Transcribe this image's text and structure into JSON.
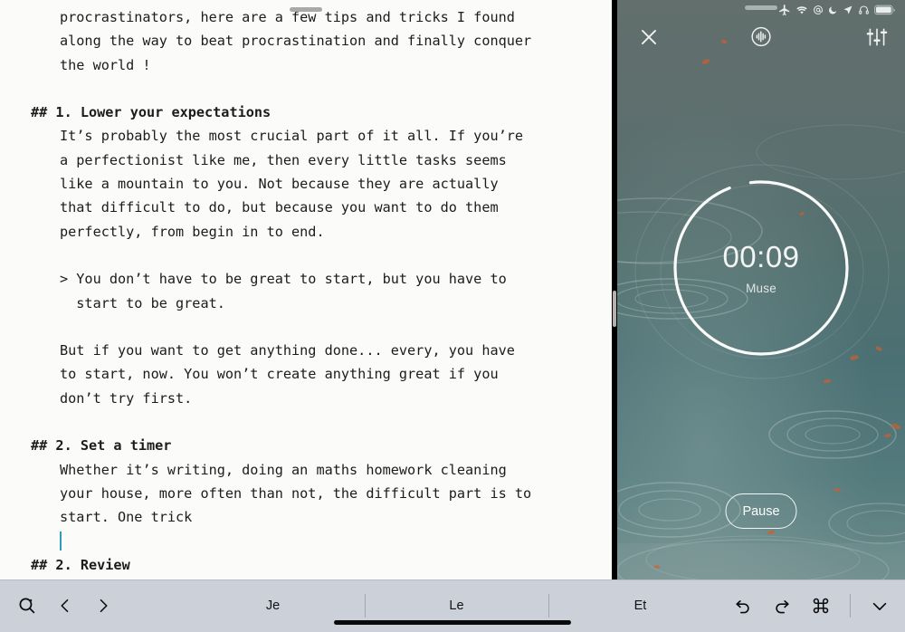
{
  "window": {
    "left_pane_name": "markdown-editor",
    "right_pane_name": "focus-timer"
  },
  "editor": {
    "document_lines": [
      {
        "type": "body",
        "text": "procrastinators, here are a few tips and tricks I found"
      },
      {
        "type": "body",
        "text": "along the way to beat procrastination and finally conquer"
      },
      {
        "type": "body",
        "text": "the world !"
      },
      {
        "type": "blank",
        "text": ""
      },
      {
        "type": "heading",
        "hashes": "##",
        "text": "1. Lower your expectations"
      },
      {
        "type": "body",
        "text": "It’s probably the most crucial part of it all. If you’re"
      },
      {
        "type": "body",
        "text": "a perfectionist like me, then every little tasks seems"
      },
      {
        "type": "body",
        "text": "like a mountain to you. Not because they are actually"
      },
      {
        "type": "body",
        "text": "that difficult to do, but because you want to do them"
      },
      {
        "type": "body",
        "text": "perfectly, from begin in to end."
      },
      {
        "type": "blank",
        "text": ""
      },
      {
        "type": "quote",
        "text": "> You don’t have to be great to start, but you have to"
      },
      {
        "type": "quote-cont",
        "text": "  start to be great."
      },
      {
        "type": "blank",
        "text": ""
      },
      {
        "type": "body",
        "text": "But if you want to get anything done... every, you have"
      },
      {
        "type": "body",
        "text": "to start, now. You won’t create anything great if you"
      },
      {
        "type": "body",
        "text": "don’t try first."
      },
      {
        "type": "blank",
        "text": ""
      },
      {
        "type": "heading",
        "hashes": "##",
        "text": "2. Set a timer"
      },
      {
        "type": "body",
        "text": "Whether it’s writing, doing an maths homework cleaning"
      },
      {
        "type": "body",
        "text": "your house, more often than not, the difficult part is to"
      },
      {
        "type": "body",
        "text": "start. One trick"
      },
      {
        "type": "caret",
        "text": ""
      },
      {
        "type": "heading",
        "hashes": "##",
        "text": "2. Review"
      }
    ],
    "caret_color": "#2f9bbd"
  },
  "timer": {
    "status_icons": [
      "airplane-mode-icon",
      "wifi-icon",
      "at-symbol-icon",
      "do-not-disturb-moon-icon",
      "location-arrow-icon",
      "headphones-icon",
      "battery-icon"
    ],
    "close_label": "close-icon",
    "sound_toggle_label": "sound-wave-icon",
    "mixer_label": "mixer-sliders-icon",
    "elapsed": "00:09",
    "sound_name": "Muse",
    "pause_label": "Pause",
    "progress_percent": 4,
    "ring_color": "#ffffff",
    "background_name": "rain-on-water-photo",
    "background_color": "#5c6f6e"
  },
  "toolbar": {
    "search_icon": "search-icon",
    "back_icon": "chevron-left-icon",
    "forward_icon": "chevron-right-icon",
    "suggestions": [
      "Je",
      "Le",
      "Et"
    ],
    "undo_icon": "undo-arrow-icon",
    "redo_icon": "redo-arrow-icon",
    "command_icon": "command-key-icon",
    "dismiss_keyboard_icon": "chevron-down-icon",
    "background_color": "#ccd0d9"
  }
}
